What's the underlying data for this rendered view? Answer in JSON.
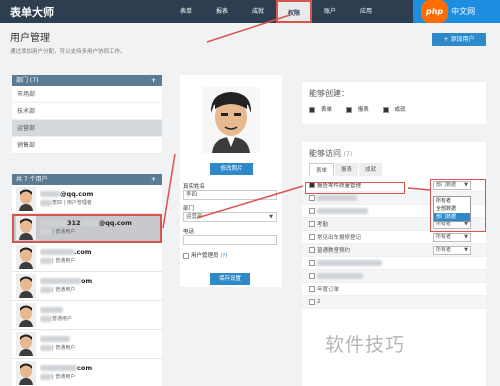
{
  "app": {
    "logo": "表单大师"
  },
  "nav": [
    {
      "label": "表单",
      "active": false
    },
    {
      "label": "报表",
      "active": false
    },
    {
      "label": "成就",
      "active": false
    },
    {
      "label": "权限",
      "active": true
    },
    {
      "label": "账户",
      "active": false
    },
    {
      "label": "应用",
      "active": false
    }
  ],
  "badge": {
    "php": "php",
    "text": "中文网"
  },
  "page": {
    "title": "用户管理",
    "description": "通过添加用户分配，可以支持多用户协同工作。",
    "add_user_button": "+ 添加用户"
  },
  "roles": {
    "header": "部门 (7)",
    "plus": "+",
    "items": [
      "市场部",
      "技术部",
      "运营部",
      "销售部"
    ],
    "selected_index": 2
  },
  "users": {
    "header": "共 7 个用户",
    "plus": "+",
    "items": [
      {
        "email": "@qq.com",
        "sub": "李四 | 用户管理者",
        "selected": false
      },
      {
        "email": "312",
        "email_suffix": "@qq.com",
        "sub": "| 普通用户",
        "selected": true
      },
      {
        "email": ".com",
        "sub": "| 普通用户",
        "selected": false
      },
      {
        "email": "om",
        "sub": "| 普通用户",
        "selected": false
      },
      {
        "email": "",
        "sub": "普通用户",
        "selected": false
      },
      {
        "email": "",
        "sub": "| 普通用户",
        "selected": false
      },
      {
        "email": "com",
        "sub": "| 普通用户",
        "selected": false
      }
    ]
  },
  "detail": {
    "edit_avatar_button": "修改照片",
    "name_label": "真实姓名",
    "name_value": "李四",
    "dept_label": "部门",
    "dept_value": "运营部",
    "phone_label": "电话",
    "phone_value": "",
    "admin_label": "用户管理员",
    "admin_hint": "(?)",
    "save_button": "保存设置"
  },
  "create": {
    "title": "能够创建：",
    "options": [
      "表单",
      "报表",
      "成就"
    ]
  },
  "access": {
    "title": "能够访问",
    "count": "(7)",
    "tabs": [
      "表单",
      "报表",
      "成就"
    ],
    "highlighted_row": {
      "name": "报告零件质量管理",
      "select": "部门数据"
    },
    "rows": [
      {
        "name": "",
        "select": ""
      },
      {
        "name": "",
        "select": ""
      },
      {
        "name": "考勤",
        "select": "所有者"
      },
      {
        "name": "常见出车报修登记",
        "select": "所有者"
      },
      {
        "name": "普通教室预约",
        "select": "所有者"
      },
      {
        "name": "",
        "select": ""
      },
      {
        "name": "",
        "select": ""
      },
      {
        "name": "年度订单",
        "select": ""
      },
      {
        "name": "2",
        "select": ""
      }
    ],
    "dropdown_options": [
      "所有者",
      "全部数据",
      "部门数据"
    ],
    "dropdown_selected": 2
  },
  "watermark": "软件技巧"
}
